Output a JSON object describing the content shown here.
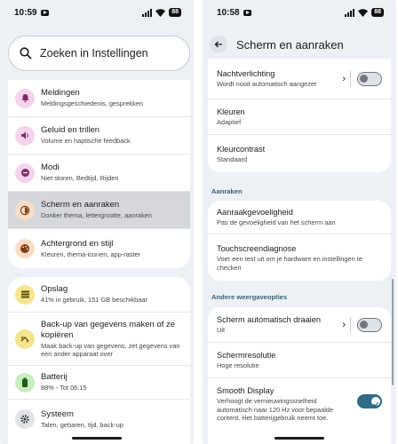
{
  "colors": {
    "accent": "#2f6a87",
    "pane_bg": "#edf1f6",
    "selected_bg": "#d6d7db"
  },
  "left": {
    "status": {
      "time": "10:59",
      "battery": "88"
    },
    "search": {
      "placeholder": "Zoeken in Instellingen",
      "icon": "search-icon"
    },
    "group1": [
      {
        "title": "Meldingen",
        "subtitle": "Meldingsgeschiedenis, gesprekken",
        "icon": "bell-icon",
        "color": "#f6d3ec"
      },
      {
        "title": "Geluid en trillen",
        "subtitle": "Volume en haptische feedback",
        "icon": "speaker-icon",
        "color": "#f6d3ec"
      },
      {
        "title": "Modi",
        "subtitle": "Niet storen, Bedtijd, Rijden",
        "icon": "minus-circle-icon",
        "color": "#f6d3ec"
      },
      {
        "title": "Scherm en aanraken",
        "subtitle": "Donker thema, lettergrootte, aanraken",
        "icon": "brightness-icon",
        "color": "#fcdcc7",
        "selected": true
      },
      {
        "title": "Achtergrond en stijl",
        "subtitle": "Kleuren, thema-iconen, app-raster",
        "icon": "palette-icon",
        "color": "#fcdcc7"
      }
    ],
    "group2": [
      {
        "title": "Opslag",
        "subtitle": "41% in gebruik, 151 GB beschikbaar",
        "icon": "storage-icon",
        "color": "#f5e58e"
      },
      {
        "title": "Back-up van gegevens maken of ze kopiëren",
        "subtitle": "Maak back-up van gegevens, zet gegevens van een ander apparaat over",
        "icon": "transfer-icon",
        "color": "#f5e58e"
      },
      {
        "title": "Batterij",
        "subtitle": "88% - Tot 06:15",
        "icon": "battery-icon",
        "color": "#c8eec0"
      },
      {
        "title": "Systeem",
        "subtitle": "Talen, gebaren, tijd, back-up",
        "icon": "gear-icon",
        "color": "#e2e3e6"
      }
    ]
  },
  "right": {
    "status": {
      "time": "10:58",
      "battery": "88"
    },
    "title": "Scherm en aanraken",
    "card1": [
      {
        "title": "Nachtverlichting",
        "subtitle": "Wordt nooit automatisch aangezet"
      },
      {
        "title": "Kleuren",
        "subtitle": "Adaptief"
      },
      {
        "title": "Kleurcontrast",
        "subtitle": "Standaard"
      }
    ],
    "section_touch": "Aanraken",
    "card2": [
      {
        "title": "Aanraakgevoeligheid",
        "subtitle": "Pas de gevoeligheid van het scherm aan"
      },
      {
        "title": "Touchscreendiagnose",
        "subtitle": "Voer een test uit om je hardware en instellingen te checken"
      }
    ],
    "section_other": "Andere weergaveopties",
    "card3": [
      {
        "title": "Scherm automatisch draaien",
        "subtitle": "Uit"
      },
      {
        "title": "Schermresolutie",
        "subtitle": "Hoge resolutie"
      },
      {
        "title": "Smooth Display",
        "subtitle": "Verhoogt de vernieuwingssnelheid automatisch naar 120 Hz voor bepaalde content. Het batterijgebruik neemt toe."
      }
    ],
    "toggles": {
      "night_light": false,
      "auto_rotate": false,
      "smooth_display": true
    }
  }
}
